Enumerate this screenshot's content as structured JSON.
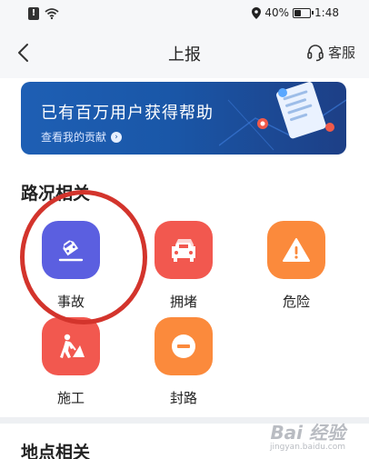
{
  "status_bar": {
    "battery_percent": "40%",
    "time": "1:48",
    "battery_level": 0.4
  },
  "header": {
    "title": "上报",
    "service_label": "客服"
  },
  "banner": {
    "title": "已有百万用户获得帮助",
    "link": "查看我的贡献"
  },
  "road_section": {
    "title": "路况相关",
    "items": [
      {
        "label": "事故",
        "icon": "accident-icon",
        "color": "#5b5fe0"
      },
      {
        "label": "拥堵",
        "icon": "traffic-jam-icon",
        "color": "#f2584f"
      },
      {
        "label": "危险",
        "icon": "danger-icon",
        "color": "#fb8a3c"
      },
      {
        "label": "施工",
        "icon": "construction-icon",
        "color": "#f2584f"
      },
      {
        "label": "封路",
        "icon": "road-closed-icon",
        "color": "#fb8a3c"
      }
    ]
  },
  "place_section": {
    "title": "地点相关"
  },
  "watermark": {
    "line1": "Bai 经验",
    "line2": "jingyan.baidu.com"
  }
}
